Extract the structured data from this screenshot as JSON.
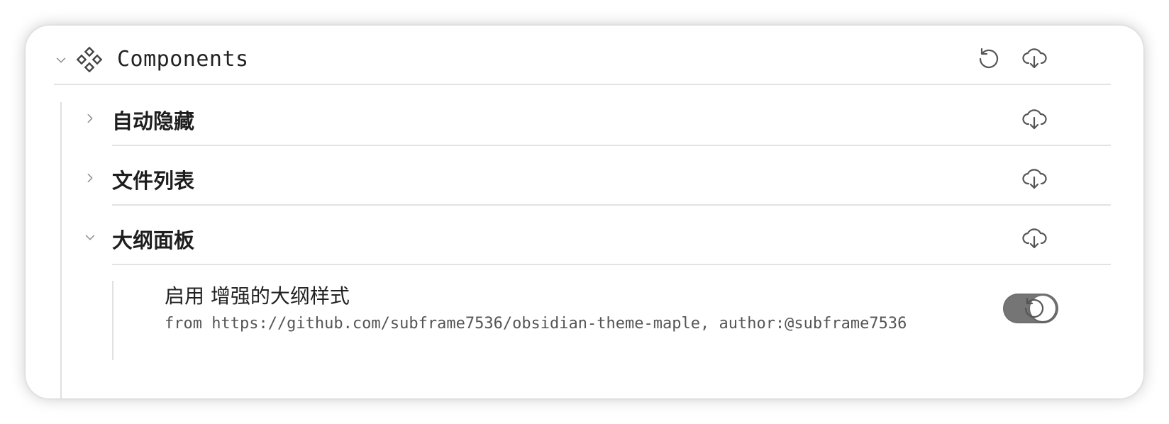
{
  "panel": {
    "title": "Components",
    "title_icon": "components-icon",
    "actions": [
      "reset-icon",
      "cloud-download-icon"
    ]
  },
  "sections": [
    {
      "title": "自动隐藏",
      "expanded": false,
      "action_icon": "cloud-download-icon"
    },
    {
      "title": "文件列表",
      "expanded": false,
      "action_icon": "cloud-download-icon"
    },
    {
      "title": "大纲面板",
      "expanded": true,
      "action_icon": "cloud-download-icon"
    }
  ],
  "setting": {
    "name": "启用  增强的大纲样式",
    "description": "from https://github.com/subframe7536/obsidian-theme-maple, author:@subframe7536",
    "toggle_on": true,
    "reset_icon": "reset-icon"
  },
  "colors": {
    "toggle_track": "#757575",
    "divider": "#e3e3e3",
    "icon": "#555555"
  }
}
